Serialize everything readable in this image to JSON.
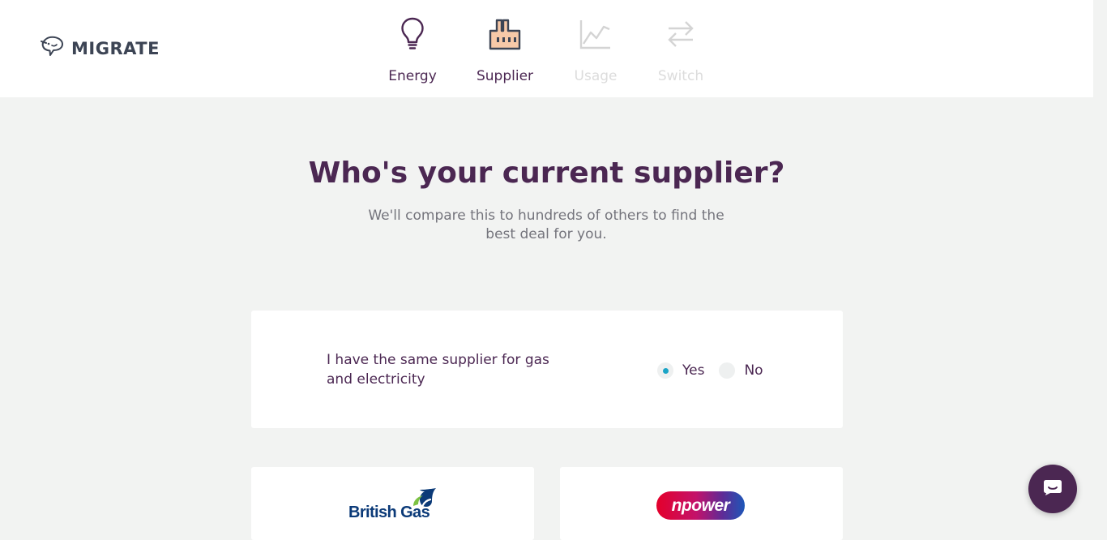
{
  "header": {
    "brand": {
      "name": "MIGRATE",
      "icon": "migrate-bird-logo-icon"
    },
    "steps": [
      {
        "label": "Energy",
        "icon": "lightbulb-icon",
        "state": "complete"
      },
      {
        "label": "Supplier",
        "icon": "factory-icon",
        "state": "current"
      },
      {
        "label": "Usage",
        "icon": "line-chart-icon",
        "state": "disabled"
      },
      {
        "label": "Switch",
        "icon": "switch-arrows-icon",
        "state": "disabled"
      }
    ]
  },
  "main": {
    "title": "Who's your current supplier?",
    "subtitle": "We'll compare this to hundreds of others to find the best deal for you.",
    "same_supplier": {
      "question": "I have the same supplier for gas and electricity",
      "options": [
        {
          "label": "Yes",
          "selected": true
        },
        {
          "label": "No",
          "selected": false
        }
      ]
    },
    "suppliers": [
      {
        "name": "British Gas",
        "logo_text": "British Gas",
        "logo_icon": "british-gas-flame-icon"
      },
      {
        "name": "npower",
        "logo_text": "npower"
      }
    ]
  },
  "chat": {
    "icon": "chat-bubble-icon"
  },
  "colors": {
    "brand_purple": "#4b2752",
    "accent_teal": "#1aa4c6",
    "page_background": "#f2f3f2",
    "muted_text": "#74747c",
    "disabled_text": "#dcdcdc"
  }
}
